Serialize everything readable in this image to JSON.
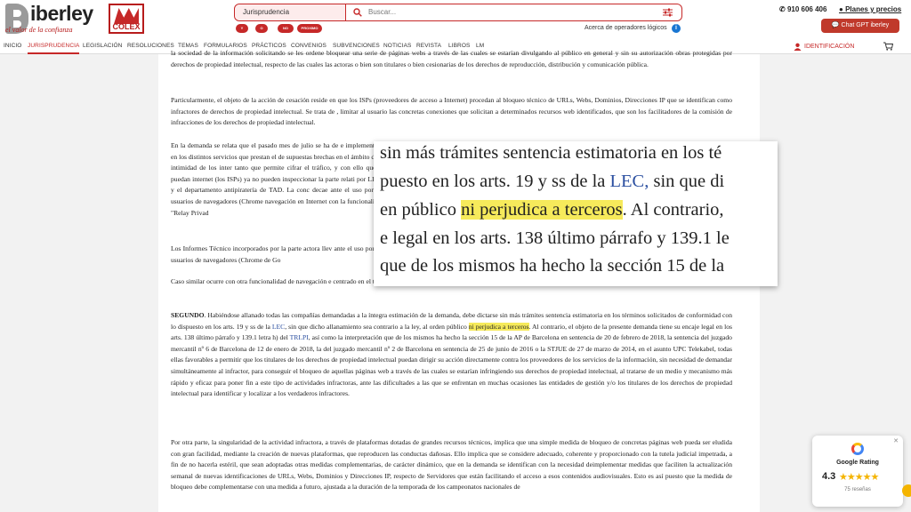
{
  "brand": {
    "name": "iberley",
    "tagline": "el valor de la confianza",
    "partner": "COLEX"
  },
  "search": {
    "category": "Jurisprudencia",
    "placeholder": "Buscar...",
    "operators": [
      "Y",
      "O",
      "NO",
      "PROXIMO"
    ],
    "operators_link": "Acerca de operadores lógicos",
    "info": "i"
  },
  "top": {
    "phone": "910 606 406",
    "plans": "Planes y precios",
    "chat": "Chat GPT iberley"
  },
  "nav": {
    "items": [
      "INICIO",
      "JURISPRUDENCIA",
      "LEGISLACIÓN",
      "RESOLUCIONES",
      "TEMAS",
      "FORMULARIOS",
      "PRÁCTICOS",
      "CONVENIOS",
      "SUBVENCIONES",
      "NOTICIAS",
      "REVISTA",
      "LIBROS",
      "LM"
    ],
    "identification": "IDENTIFICACIÓN"
  },
  "document": {
    "p1": "la sociedad de la información solicitando se les ordene bloquear una serie de páginas webs a través de las cuales se estarían divulgando al público en general y sin su autorización obras protegidas por derechos de propiedad intelectual, respecto de las cuales las actoras o bien son titulares o bien cesionarias de los derechos de reproducción, distribución y comunicación pública.",
    "p2": "Particularmente, el objeto de la acción de cesación reside en que los ISPs (proveedores de acceso a Internet) procedan al bloqueo técnico de URLs, Webs, Dominios, Direcciones IP que se identifican como infractores de derechos de propiedad intelectual. Se trata de , limitar al usuario las concretas conexiones que solicitan a determinados recursos web identificados, que son los facilitadores de la comisión de infracciones de los derechos de propiedad intelectual.",
    "p3": "En la demanda se relata que el pasado mes de julio se ha de e implementado en los distintos servicios que prestan el de supuestas brechas en el ámbito de la intimidad de los inter tanto que permite cifrar el tráfico, y con ello que se puedan internet (los ISPs) ya no pueden inspeccionar la parte relati por LLCP y el departamento antipiratería de TAD. La conc decae ante el uso por los usuarios de navegadores (Chrome navegación en Internet con la funcionalidad \"Relay Privad",
    "p4": "Los Informes Técnico incorporados por la parte actora llev ante el uso por los usuarios de navegadores (Chrome de Go",
    "p5": "Caso similar ocurre con otra funcionalidad de navegación e centrado en el tráfico web generado desde el navegador Safari y algunas conexiones específicas del sistema operativo.",
    "p6_label": "SEGUNDO",
    "p6_a": ". Habiéndose allanado todas las compañías demandadas a la íntegra estimación de la demanda, debe dictarse sin más trámites sentencia estimatoria en los términos solicitados de conformidad con lo dispuesto en los arts. 19 y ss de la ",
    "p6_lec": "LEC",
    "p6_b": ", sin que dicho allanamiento sea contrario a la ley, al orden público ",
    "p6_hl": "ni perjudica a terceros",
    "p6_c": ". Al contrario, el objeto de la presente demanda tiene su encaje legal en los arts. 138 último párrafo y 139.1 letra h) del ",
    "p6_trlpi": "TRLPI",
    "p6_d": ", así como la interpretación que de los mismos ha hecho la sección 15 de la AP de Barcelona en sentencia de 20 de febrero de 2018, la sentencia del juzgado mercantil nº 6 de Barcelona de 12 de enero de 2018, la del juzgado mercantil nº 2 de Barcelona en sentencia de 25 de junio de 2016 o la STJUE de 27 de marzo de 2014, en el asunto UPC Telekabel, todas ellas favorables a permitir que los titulares de los derechos de propiedad intelectual puedan dirigir su acción directamente contra los proveedores de los servicios de la información, sin necesidad de demandar simultáneamente al infractor, para conseguir el bloqueo de aquellas páginas web a través de las cuales se estarían infringiendo sus derechos de propiedad intelectual, al tratarse de un medio y mecanismo más rápido y eficaz para poner fin a este tipo de actividades infractoras, ante las dificultades a las que se enfrentan en muchas ocasiones las entidades de gestión y/o los titulares de los derechos de propiedad intelectual para identificar y localizar a los verdaderos infractores.",
    "p7": "Por otra parte, la singularidad de la actividad infractora, a través de plataformas dotadas de grandes recursos técnicos, implica que una simple medida de bloqueo de concretas páginas web pueda ser eludida con gran facilidad, mediante la creación de nuevas plataformas, que reproducen las conductas dañosas. Ello implica que se considere adecuado, coherente y proporcionado con la tutela judicial impetrada, a fin de no hacerla estéril, que sean adoptadas otras medidas complementarias, de carácter dinámico, que en la demanda se identifican con la necesidad deimplementar medidas que faciliten la actualización semanal de nuevas identificaciones de URLs, Webs, Dominios y Direcciones IP, respecto de Servidores que están facilitando el acceso a esos contenidos audiovisuales. Esto es así puesto que la medida de bloqueo debe complementarse con una medida a futuro, ajustada a la duración de la temporada de los campeonatos nacionales de"
  },
  "magnifier": {
    "line1": "sin más trámites sentencia estimatoria en los té",
    "line2_a": "puesto en los arts. 19 y ss de la ",
    "line2_lec": "LEC,",
    "line2_b": " sin que di",
    "line3_a": "en público ",
    "line3_hl": "ni perjudica a terceros",
    "line3_b": ". Al contrario,",
    "line4": "e legal en los arts. 138 último párrafo y 139.1 le",
    "line5": "que de los mismos ha hecho la sección 15 de la"
  },
  "google": {
    "title": "Google Rating",
    "score": "4.3",
    "stars": 4.3,
    "stars_text": "★★★★★",
    "count": "75 reseñas",
    "close": "✕"
  },
  "colors": {
    "brand_red": "#c62828",
    "highlight": "#f6ea5b",
    "link": "#2b4fa0",
    "star": "#f4b400"
  }
}
